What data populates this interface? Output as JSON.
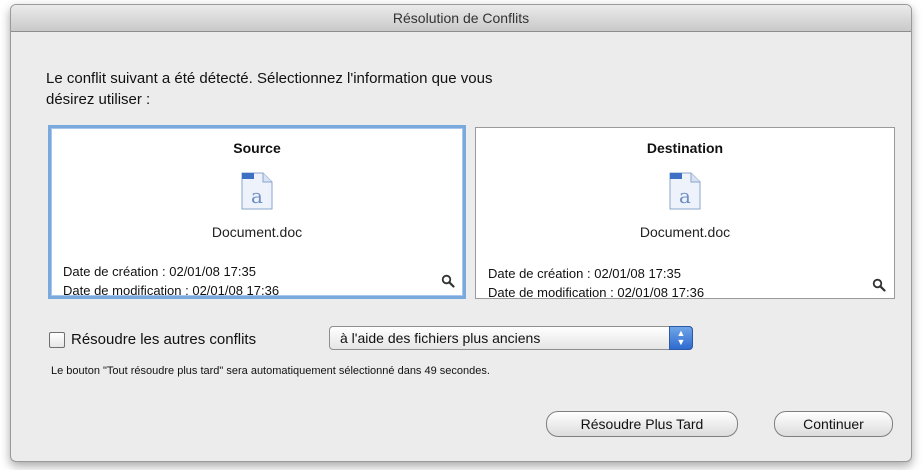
{
  "window": {
    "title": "Résolution de Conflits"
  },
  "message": {
    "line1": "Le conflit suivant a été détecté. Sélectionnez l'information que vous",
    "line2": "désirez utiliser :"
  },
  "source": {
    "heading": "Source",
    "file_name": "Document.doc",
    "created": "Date de création : 02/01/08 17:35",
    "modified": "Date de modification : 02/01/08 17:36",
    "icon": "doc-icon"
  },
  "destination": {
    "heading": "Destination",
    "file_name": "Document.doc",
    "created": "Date de création : 02/01/08 17:35",
    "modified": "Date de modification : 02/01/08 17:36",
    "icon": "doc-icon"
  },
  "resolve_others": {
    "label": "Résoudre les autres conflits",
    "checked": false,
    "selected_option": "à l'aide des fichiers plus anciens"
  },
  "countdown_text": "Le bouton \"Tout résoudre plus tard\" sera automatiquement sélectionné dans 49 secondes.",
  "buttons": {
    "later": "Résoudre Plus Tard",
    "continue": "Continuer"
  },
  "colors": {
    "selection_border": "#7aa9de",
    "popup_accent": "#2f6ad0"
  }
}
